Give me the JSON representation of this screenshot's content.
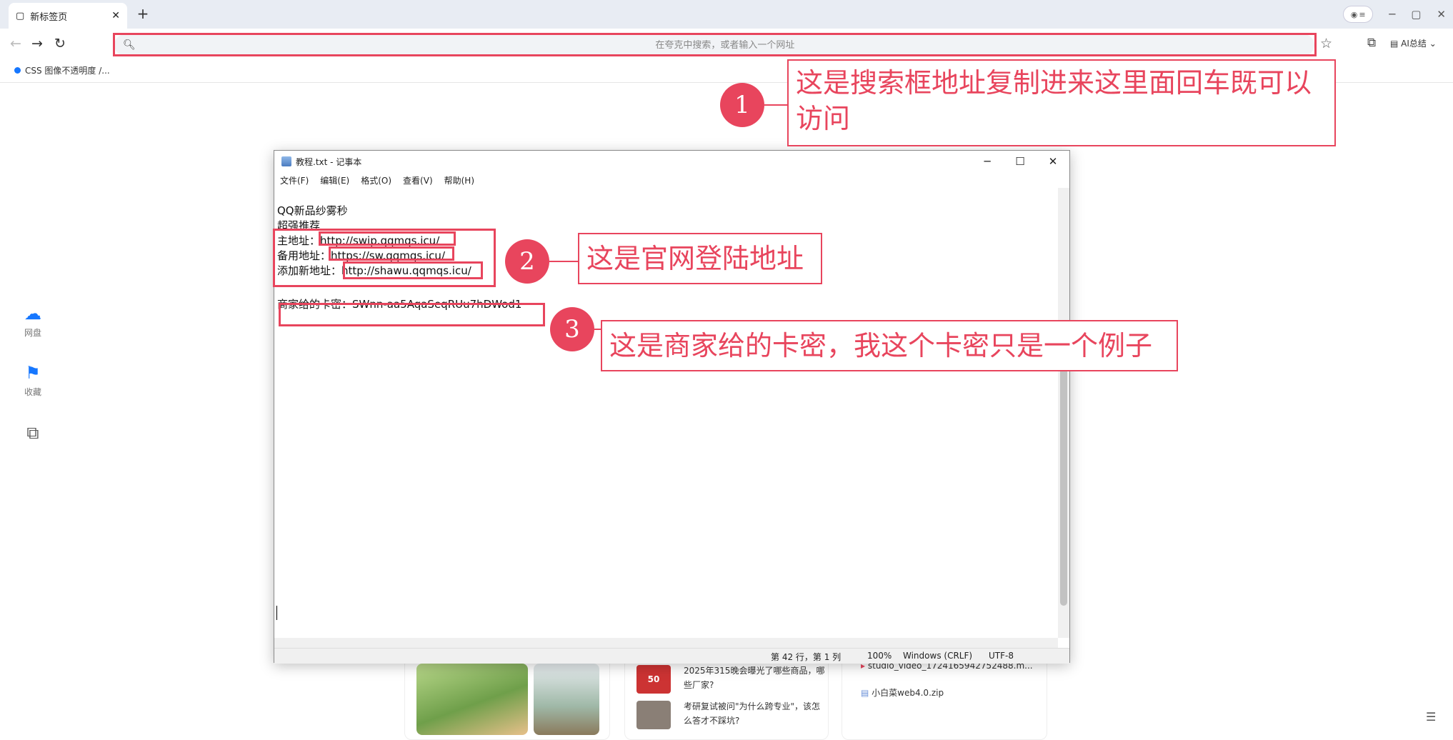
{
  "browser": {
    "tab_title": "新标签页",
    "search_placeholder": "在夸克中搜索，或者输入一个网址",
    "ai_label": "AI总结",
    "bookmark": "CSS 图像不透明度 /..."
  },
  "sidebar": {
    "items": [
      {
        "label": "网盘",
        "icon": "cloud-icon"
      },
      {
        "label": "收藏",
        "icon": "bookmark-icon"
      },
      {
        "label": "",
        "icon": "window-icon"
      }
    ]
  },
  "bottom": {
    "news": [
      {
        "text": "2025年315晚会曝光了哪些商品，哪些厂家?",
        "badge": "50"
      },
      {
        "text": "考研复试被问\"为什么跨专业\"，该怎么答才不踩坑?"
      }
    ],
    "files": [
      "studio_video_1724165942752488.m...",
      "小白菜web4.0.zip"
    ]
  },
  "notepad": {
    "title": "教程.txt - 记事本",
    "menu": [
      "文件(F)",
      "编辑(E)",
      "格式(O)",
      "查看(V)",
      "帮助(H)"
    ],
    "lines": [
      "QQ新品纱雾秒",
      "超强推荐"
    ],
    "main_label": "主地址：",
    "main_url": "http://swip.qqmqs.icu/",
    "backup_label": "备用地址：",
    "backup_url": "https://sw.qqmqs.icu/",
    "new_label": "添加新地址：",
    "new_url": "http://shawu.qqmqs.icu/",
    "key_line": "商家给的卡密：SWnn-aa5AqaSeqRUu7hDWod1",
    "status": {
      "pos": "第 42 行，第 1 列",
      "zoom": "100%",
      "eol": "Windows (CRLF)",
      "enc": "UTF-8"
    }
  },
  "annotations": [
    {
      "num": "1",
      "text": "这是搜索框地址复制进来这里面回车既可以访问"
    },
    {
      "num": "2",
      "text": "这是官网登陆地址"
    },
    {
      "num": "3",
      "text": "这是商家给的卡密，我这个卡密只是一个例子"
    }
  ],
  "colors": {
    "annotation": "#e8455d",
    "accent": "#1677ff"
  }
}
